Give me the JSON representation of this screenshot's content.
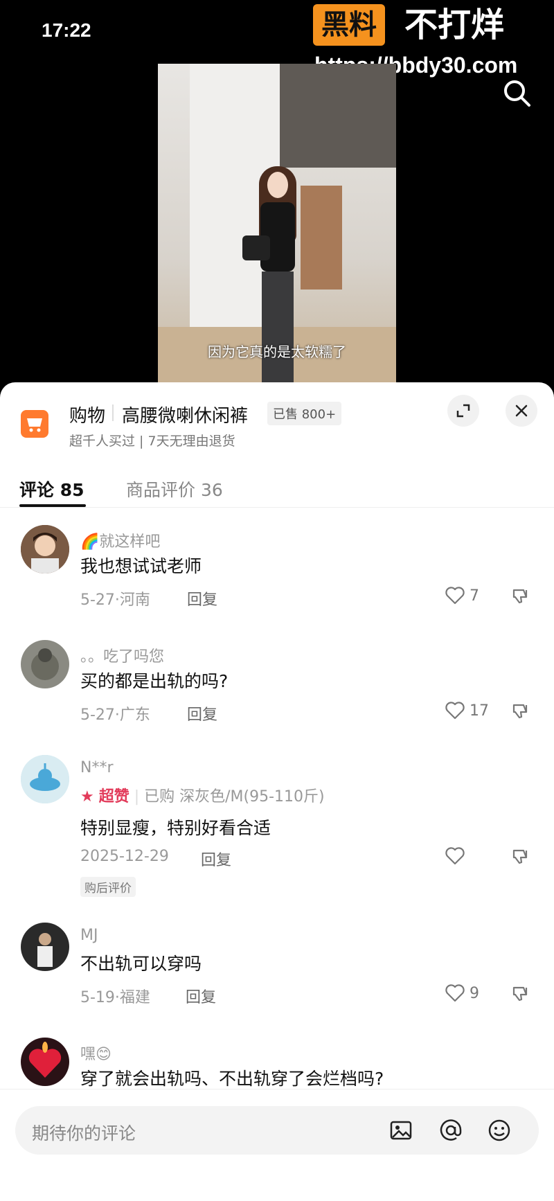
{
  "status": {
    "time": "17:22"
  },
  "watermark": {
    "badge": "黑料",
    "text": "不打烊",
    "url": "https://bbdy30.com"
  },
  "video": {
    "subtitle": "因为它真的是太软糯了"
  },
  "product": {
    "title": "购物",
    "name": "高腰微喇休闲裤",
    "sold": "已售 800+",
    "subtitle": "超千人买过 | 7天无理由退货",
    "icons": [
      "cart-icon",
      "expand-icon",
      "close-icon"
    ]
  },
  "tabs": [
    {
      "label": "评论 85",
      "active": true
    },
    {
      "label": "商品评价 36",
      "active": false
    }
  ],
  "comments": [
    {
      "user": "🌈就这样吧",
      "text": "我也想试试老师",
      "meta": "5-27·河南",
      "reply": "回复",
      "likes": "7"
    },
    {
      "user": "。。吃了吗您",
      "text": "买的都是出轨的吗?",
      "meta": "5-27·广东",
      "reply": "回复",
      "likes": "17"
    },
    {
      "user": "N**r",
      "badge": "超赞",
      "purchase": "已购 深灰色/M(95-110斤)",
      "text": "特别显瘦，特别好看合适",
      "meta": "2025-12-29",
      "reply": "回复",
      "likes": "",
      "tag": "购后评价"
    },
    {
      "user": "MJ",
      "text": "不出轨可以穿吗",
      "meta": "5-19·福建",
      "reply": "回复",
      "likes": "9"
    },
    {
      "user": "嘿😊",
      "text": "穿了就会出轨吗、不出轨穿了会烂档吗?"
    }
  ],
  "input": {
    "placeholder": "期待你的评论",
    "icons": [
      "image-icon",
      "at-icon",
      "emoji-icon"
    ]
  },
  "colors": {
    "accent": "#ff7a2e",
    "watermark": "#f5921e",
    "badge": "#e23b5a"
  }
}
